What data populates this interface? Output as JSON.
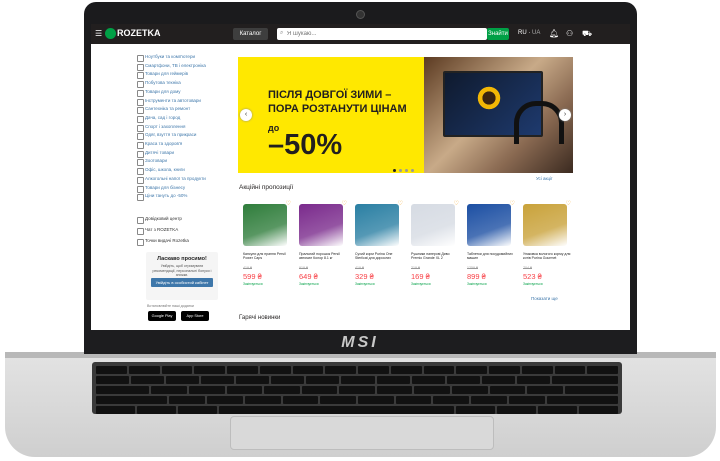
{
  "header": {
    "brand": "ROZETKA",
    "catalog_label": "Каталог",
    "search_placeholder": "Я шукаю...",
    "search_button": "Знайти",
    "lang_ru": "RU",
    "lang_ua": "UA"
  },
  "sidebar": {
    "items": [
      {
        "label": "Ноутбуки та комп'ютери"
      },
      {
        "label": "Смартфони, ТВ і електроніка"
      },
      {
        "label": "Товари для геймерів"
      },
      {
        "label": "Побутова техніка"
      },
      {
        "label": "Товари для дому"
      },
      {
        "label": "Інструменти та автотовари"
      },
      {
        "label": "Сантехніка та ремонт"
      },
      {
        "label": "Дача, сад і город"
      },
      {
        "label": "Спорт і захоплення"
      },
      {
        "label": "Одяг, взуття та прикраси"
      },
      {
        "label": "Краса та здоров'я"
      },
      {
        "label": "Дитячі товари"
      },
      {
        "label": "Зоотовари"
      },
      {
        "label": "Офіс, школа, книги"
      },
      {
        "label": "Алкогольні напої та продукти"
      },
      {
        "label": "Товари для бізнесу"
      },
      {
        "label": "Ціни тануть до -50%"
      }
    ],
    "links": [
      {
        "label": "Довідковий центр"
      },
      {
        "label": "Чат з ROZETKA"
      },
      {
        "label": "Точки видачі Rozetka"
      }
    ],
    "promo": {
      "title": "Ласкаво просимо!",
      "text": "Увійдіть, щоб отримувати рекомендації, персональні бонуси і знижки.",
      "login": "Увійдіть в особистий кабінет"
    },
    "apps_label": "Встановлюйте наші додатки",
    "google_play": "Google Play",
    "app_store": "App Store"
  },
  "banner": {
    "line1": "ПІСЛЯ ДОВГОЇ ЗИМИ –",
    "line2": "ПОРА РОЗТАНУТИ ЦІНАМ",
    "do": "до",
    "percent": "–50%"
  },
  "section": {
    "title": "Акційні пропозиції",
    "all_link": "Усі акції",
    "more_link": "Показати ще",
    "new_title": "Гарячі новинки"
  },
  "products": [
    {
      "name": "Капсули для прання Persil Power Caps",
      "old": "419 ₴",
      "price": "599 ₴",
      "note": "Закінчується",
      "color": "#2f7d3b"
    },
    {
      "name": "Пральний порошок Persil автомат Колор 8.1 кг",
      "old": "919 ₴",
      "price": "649 ₴",
      "note": "Закінчується",
      "color": "#7a2a8c"
    },
    {
      "name": "Сухий корм Purina One Sterilcat для дорослих",
      "old": "419 ₴",
      "price": "329 ₴",
      "note": "Закінчується",
      "color": "#2a7fa3"
    },
    {
      "name": "Рушники паперові Диво Premio Grande XL 2",
      "old": "219 ₴",
      "price": "169 ₴",
      "note": "Закінчується",
      "color": "#d6dbe3"
    },
    {
      "name": "Таблетки для посудомийних машин",
      "old": "1259 ₴",
      "price": "899 ₴",
      "note": "Закінчується",
      "color": "#1c4fa3"
    },
    {
      "name": "Упаковка вологого корму для котів Purina Gourmet",
      "old": "704 ₴",
      "price": "523 ₴",
      "note": "Закінчується",
      "color": "#c9a23a"
    }
  ],
  "laptop_logo": "MSI"
}
